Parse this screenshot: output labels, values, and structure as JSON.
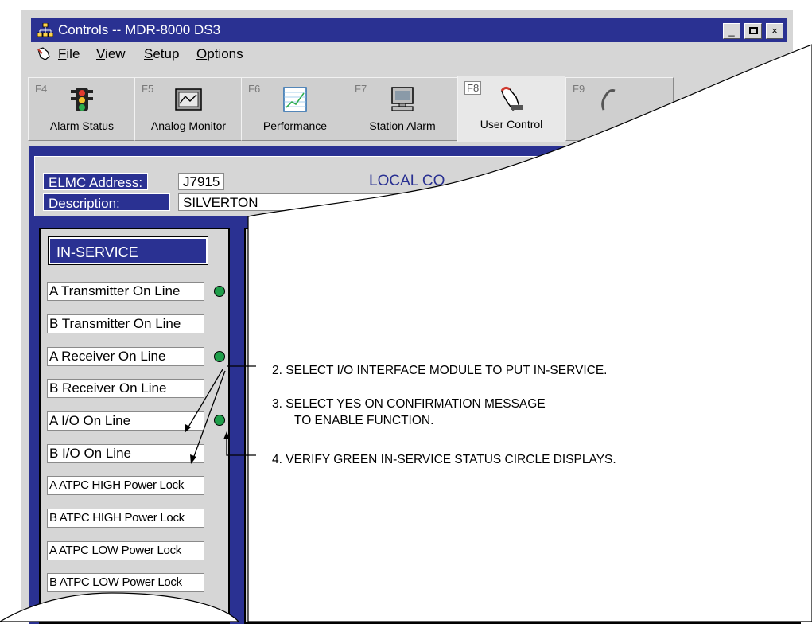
{
  "window": {
    "title": "Controls -- MDR-8000 DS3",
    "buttons": {
      "minimize": "_",
      "maximize": "",
      "close": "×"
    }
  },
  "menu": [
    {
      "mnemonic": "F",
      "rest": "ile"
    },
    {
      "mnemonic": "V",
      "rest": "iew"
    },
    {
      "mnemonic": "S",
      "rest": "etup"
    },
    {
      "mnemonic": "O",
      "rest": "ptions"
    }
  ],
  "tabs": [
    {
      "key": "F4",
      "label": "Alarm Status",
      "icon": "traffic-light-icon"
    },
    {
      "key": "F5",
      "label": "Analog Monitor",
      "icon": "analog-monitor-icon"
    },
    {
      "key": "F6",
      "label": "Performance",
      "icon": "performance-chart-icon"
    },
    {
      "key": "F7",
      "label": "Station Alarm",
      "icon": "computer-monitor-icon"
    },
    {
      "key": "F8",
      "label": "User Control",
      "icon": "hand-pointer-icon",
      "selected": true
    },
    {
      "key": "F9",
      "label": "",
      "icon": "wrench-icon"
    }
  ],
  "header": {
    "elmc_label": "ELMC Address:",
    "elmc_value": "J7915",
    "description_label": "Description:",
    "description_value": "SILVERTON",
    "local_title": "LOCAL CO"
  },
  "inservice": {
    "title": "IN-SERVICE",
    "items": [
      {
        "label": "A Transmitter On Line",
        "led": true
      },
      {
        "label": "B Transmitter On Line",
        "led": false
      },
      {
        "label": "A Receiver On Line",
        "led": true
      },
      {
        "label": "B Receiver On Line",
        "led": false
      },
      {
        "label": "A I/O On Line",
        "led": false
      },
      {
        "label": "B I/O On Line",
        "led": true
      },
      {
        "label": "A ATPC HIGH Power Lock",
        "led": false
      },
      {
        "label": "B ATPC HIGH Power Lock",
        "led": false
      },
      {
        "label": "A ATPC LOW Power Lock",
        "led": false
      },
      {
        "label": "B ATPC LOW Power Lock",
        "led": false
      }
    ]
  },
  "callouts": {
    "step2": "2. SELECT I/O INTERFACE MODULE TO PUT IN-SERVICE.",
    "step3_line1": "3. SELECT YES ON CONFIRMATION MESSAGE",
    "step3_line2": "TO ENABLE FUNCTION.",
    "step4": "4. VERIFY GREEN IN-SERVICE STATUS CIRCLE DISPLAYS."
  },
  "colors": {
    "titlebar": "#2a3192",
    "led_green": "#1f9e4a",
    "panel": "#2a3192"
  }
}
